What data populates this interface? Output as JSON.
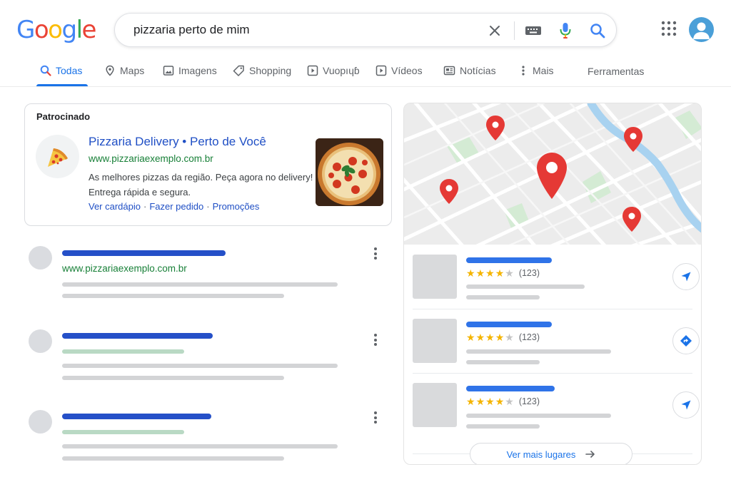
{
  "header": {
    "logo": "Google",
    "search_query": "pizzaria perto de mim",
    "icons": [
      "clear-icon",
      "keyboard-icon",
      "microphone-icon",
      "search-icon",
      "apps-grid-icon",
      "account-avatar-icon"
    ]
  },
  "tabs": [
    {
      "label": "Todas",
      "icon": "search-icon",
      "active": true
    },
    {
      "label": "Maps",
      "icon": "map-pin-icon"
    },
    {
      "label": "Imagens",
      "icon": "image-icon"
    },
    {
      "label": "Shopping",
      "icon": "tag-icon"
    },
    {
      "label": "Vuopıɥɓ",
      "icon": "play-square-icon"
    },
    {
      "label": "Vídeos",
      "icon": "video-icon"
    },
    {
      "label": "Notícias",
      "icon": "news-icon"
    },
    {
      "label": "Mais",
      "icon": "more-vert-icon"
    }
  ],
  "tools_label": "Ferramentas",
  "ad": {
    "label": "Patrocinado",
    "title": "Pizzaria Delivery • Perto de Você",
    "url": "www.pizzariaexemplo.com.br",
    "description_line1": "As melhores pizzas da região. Peça agora no delivery!",
    "description_line2": "Entrega rápida e segura.",
    "sitelinks": [
      "Ver cardápio",
      "Fazer pedido",
      "Promoções"
    ],
    "logo_icon": "pizza-slice-icon"
  },
  "results": [
    {
      "url": "www.pizzariaexemplo.com.br"
    }
  ],
  "local_pack": {
    "places": [
      {
        "rating": 4.0,
        "reviews": "(123)"
      },
      {
        "rating": 4.5,
        "reviews": "(123)"
      },
      {
        "rating": 4.5,
        "reviews": "(123)"
      }
    ],
    "more_label": "Ver mais lugares"
  },
  "colors": {
    "google_blue": "#4285F4",
    "google_red": "#EA4335",
    "google_yellow": "#FBBC05",
    "google_green": "#34A853",
    "link_blue": "#1f4fc5",
    "url_green": "#188038",
    "accent": "#1a73e8",
    "map_pin": "#e53935"
  }
}
